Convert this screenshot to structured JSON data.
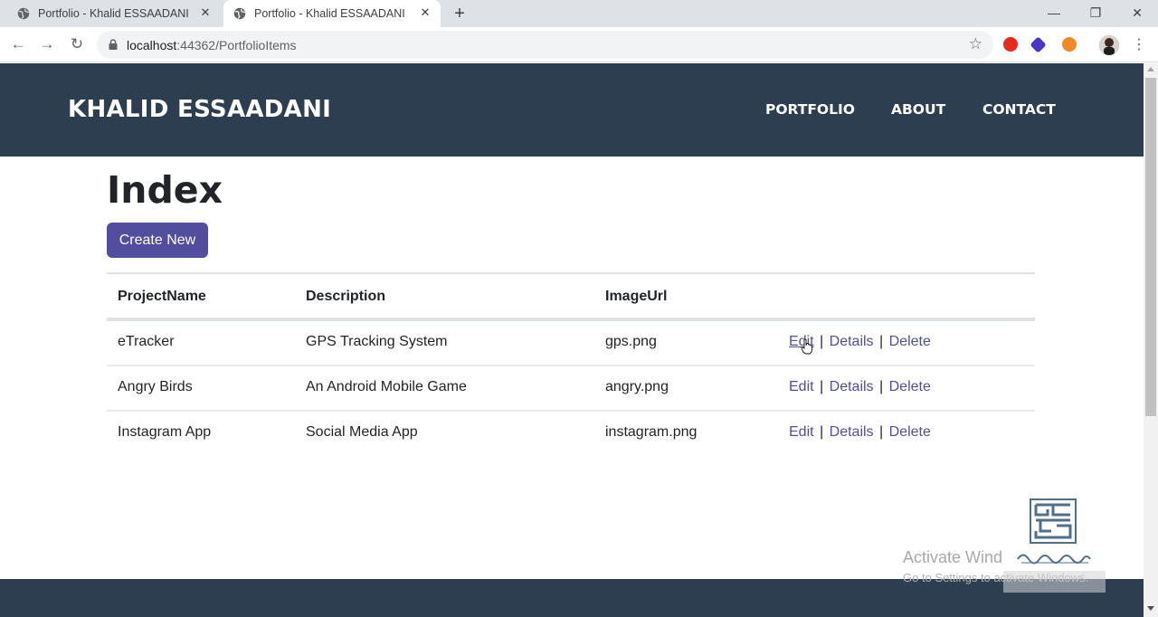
{
  "browser": {
    "tabs": [
      {
        "title": "Portfolio - Khalid ESSAADANI",
        "active": false
      },
      {
        "title": "Portfolio - Khalid ESSAADANI",
        "active": true
      }
    ],
    "address": {
      "host": "localhost",
      "rest": ":44362/PortfolioItems"
    }
  },
  "site": {
    "brand": "KHALID ESSAADANI",
    "nav": [
      "PORTFOLIO",
      "ABOUT",
      "CONTACT"
    ]
  },
  "page": {
    "title": "Index",
    "create_label": "Create New",
    "columns": [
      "ProjectName",
      "Description",
      "ImageUrl"
    ],
    "rows": [
      {
        "name": "eTracker",
        "description": "GPS Tracking System",
        "image": "gps.png"
      },
      {
        "name": "Angry Birds",
        "description": "An Android Mobile Game",
        "image": "angry.png"
      },
      {
        "name": "Instagram App",
        "description": "Social Media App",
        "image": "instagram.png"
      }
    ],
    "actions": {
      "edit": "Edit",
      "details": "Details",
      "delete": "Delete",
      "separator": "|"
    }
  },
  "overlay": {
    "activate_title": "Activate Wind",
    "activate_sub": "Go to Settings to activate Windows."
  },
  "colors": {
    "navbar": "#2c3e50",
    "accent": "#524e9e"
  }
}
